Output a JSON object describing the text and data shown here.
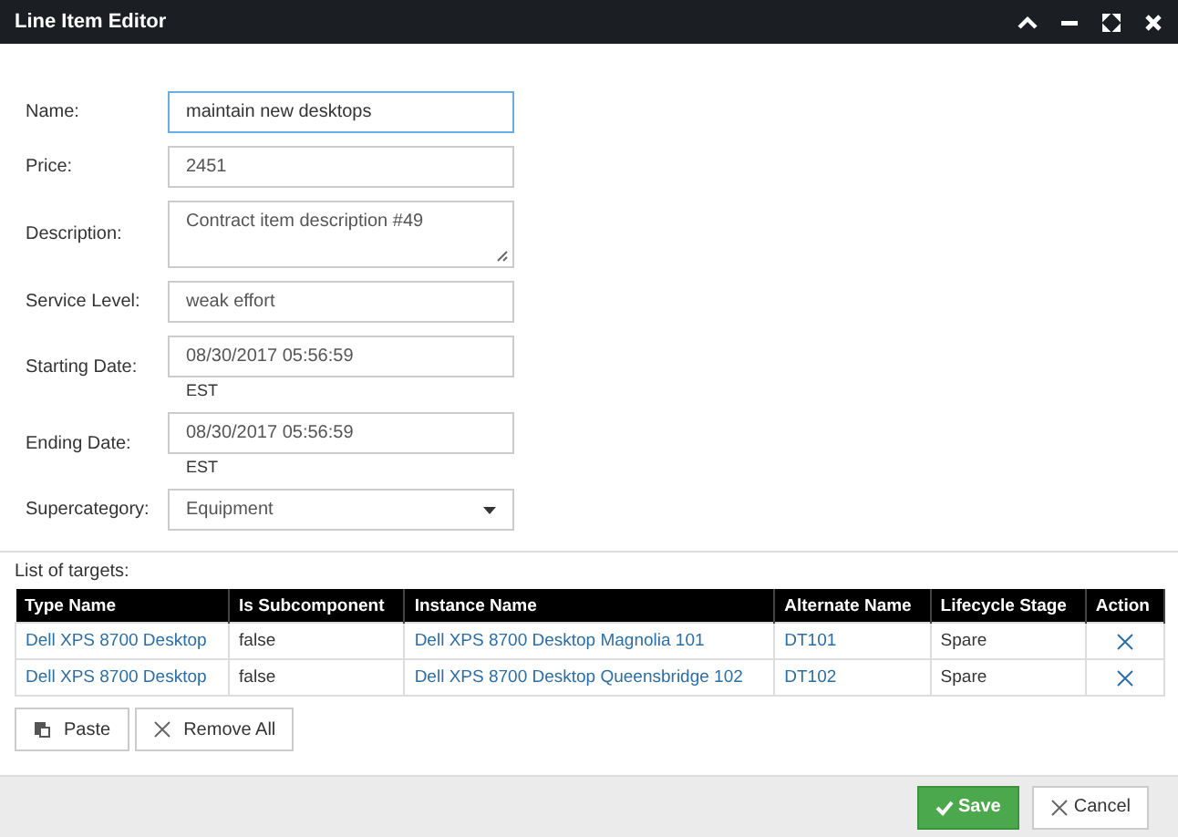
{
  "window": {
    "title": "Line Item Editor"
  },
  "form": [
    {
      "kind": "text",
      "label": "Name:",
      "value": "maintain new desktops",
      "focused": true
    },
    {
      "kind": "text",
      "label": "Price:",
      "value": "2451",
      "focused": false
    },
    {
      "kind": "textarea",
      "label": "Description:",
      "value": "Contract item description #49",
      "focused": false
    },
    {
      "kind": "text",
      "label": "Service Level:",
      "value": "weak effort",
      "focused": false
    },
    {
      "kind": "date",
      "label": "Starting Date:",
      "value": "08/30/2017 05:56:59",
      "zone": "EST",
      "focused": false
    },
    {
      "kind": "date",
      "label": "Ending Date:",
      "value": "08/30/2017 05:56:59",
      "zone": "EST",
      "focused": false
    },
    {
      "kind": "select",
      "label": "Supercategory:",
      "value": "Equipment",
      "focused": false
    }
  ],
  "targets": {
    "label": "List of targets:",
    "columns": [
      "Type Name",
      "Is Subcomponent",
      "Instance Name",
      "Alternate Name",
      "Lifecycle Stage",
      "Action"
    ],
    "rows": [
      [
        "Dell XPS 8700 Desktop",
        "false",
        "Dell XPS 8700 Desktop Magnolia 101",
        "DT101",
        "Spare"
      ],
      [
        "Dell XPS 8700 Desktop",
        "false",
        "Dell XPS 8700 Desktop Queensbridge 102",
        "DT102",
        "Spare"
      ]
    ],
    "buttons": [
      {
        "kind": "paste",
        "label": "Paste"
      },
      {
        "kind": "remove",
        "label": "Remove All"
      }
    ]
  },
  "footer": {
    "buttons": [
      {
        "kind": "save",
        "label": "Save"
      },
      {
        "kind": "cancel",
        "label": "Cancel"
      }
    ]
  }
}
